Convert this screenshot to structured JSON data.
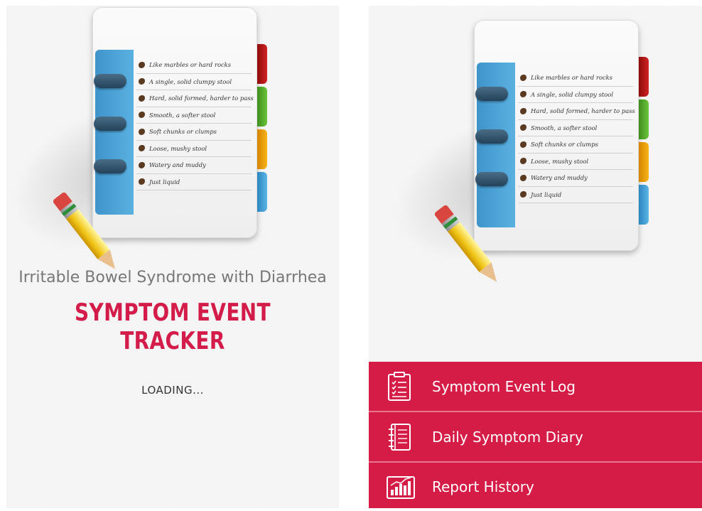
{
  "stool_scale": [
    {
      "label": "Like marbles or hard rocks"
    },
    {
      "label": "A single, solid clumpy stool"
    },
    {
      "label": "Hard, solid formed, harder to pass"
    },
    {
      "label": "Smooth, a softer stool"
    },
    {
      "label": "Soft chunks or clumps"
    },
    {
      "label": "Loose, mushy stool"
    },
    {
      "label": "Watery and muddy"
    },
    {
      "label": "Just liquid"
    }
  ],
  "splash": {
    "subtitle": "Irritable Bowel Syndrome with Diarrhea",
    "title": "SYMPTOM EVENT TRACKER",
    "loading": "LOADING..."
  },
  "menu": {
    "items": [
      {
        "label": "Symptom Event Log",
        "icon": "clipboard-checklist-icon"
      },
      {
        "label": "Daily Symptom Diary",
        "icon": "notebook-icon"
      },
      {
        "label": "Report History",
        "icon": "bar-chart-report-icon"
      }
    ]
  },
  "colors": {
    "accent": "#d41c46",
    "title": "#d31c49",
    "notebook_cover": "#4aa3d6",
    "tabs": [
      "#c01a1a",
      "#5cb530",
      "#f2a30f",
      "#4aa8dd"
    ]
  }
}
